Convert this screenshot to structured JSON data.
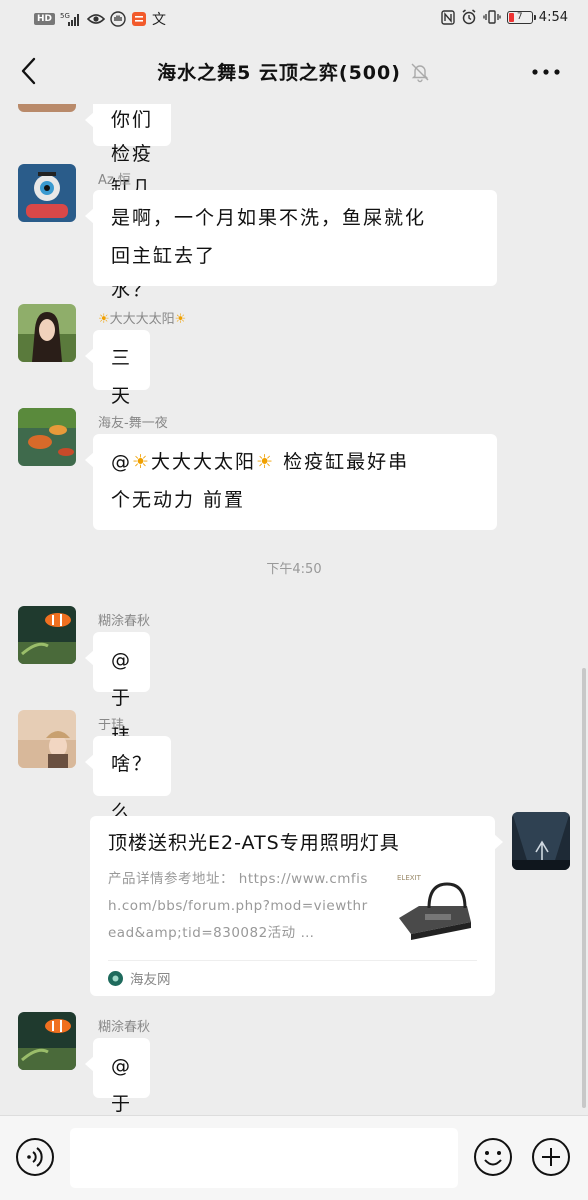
{
  "status_bar": {
    "hd": "HD",
    "network": "5G",
    "battery_level": "7",
    "time": "4:54"
  },
  "header": {
    "title": "海水之舞5 云顶之弈(500)",
    "back_icon": "chevron-left-icon",
    "mute_icon": "bell-off-icon",
    "more_icon": "more-icon"
  },
  "messages": [
    {
      "sender": "",
      "text": "你们检疫缸几天换一次水？"
    },
    {
      "sender": "Az.恒",
      "text_line1": "是啊，一个月如果不洗，鱼屎就化",
      "text_line2": "回主缸去了"
    },
    {
      "sender_prefix": "☀",
      "sender": "大大大太阳",
      "sender_suffix": "☀",
      "text": "三天"
    },
    {
      "sender": "海友-舞一夜",
      "text_line1_a": "@",
      "text_line1_sun1": "☀",
      "text_line1_b": "大大大太阳",
      "text_line1_sun2": "☀",
      "text_line1_c": " 检疫缸最好串",
      "text_line2": "个无动力 前置"
    },
    {
      "sender": "糊涂春秋",
      "text": "@于玮  怎么样了"
    },
    {
      "sender": "于玮",
      "text": "啥？"
    },
    {
      "sender": "糊涂春秋",
      "text": "@于玮  鱼啊"
    }
  ],
  "timestamp": "下午4:50",
  "link_card": {
    "title": "顶楼送积光E2-ATS专用照明灯具",
    "description": "产品详情参考地址： https://www.cmfish.com/bbs/forum.php?mod=viewthread&amp;tid=830082活动 …",
    "source": "海友网",
    "thumb_label": "ELEXIT"
  },
  "input_bar": {
    "placeholder": "",
    "voice_icon": "voice-icon",
    "emoji_icon": "emoji-icon",
    "plus_icon": "plus-icon"
  }
}
